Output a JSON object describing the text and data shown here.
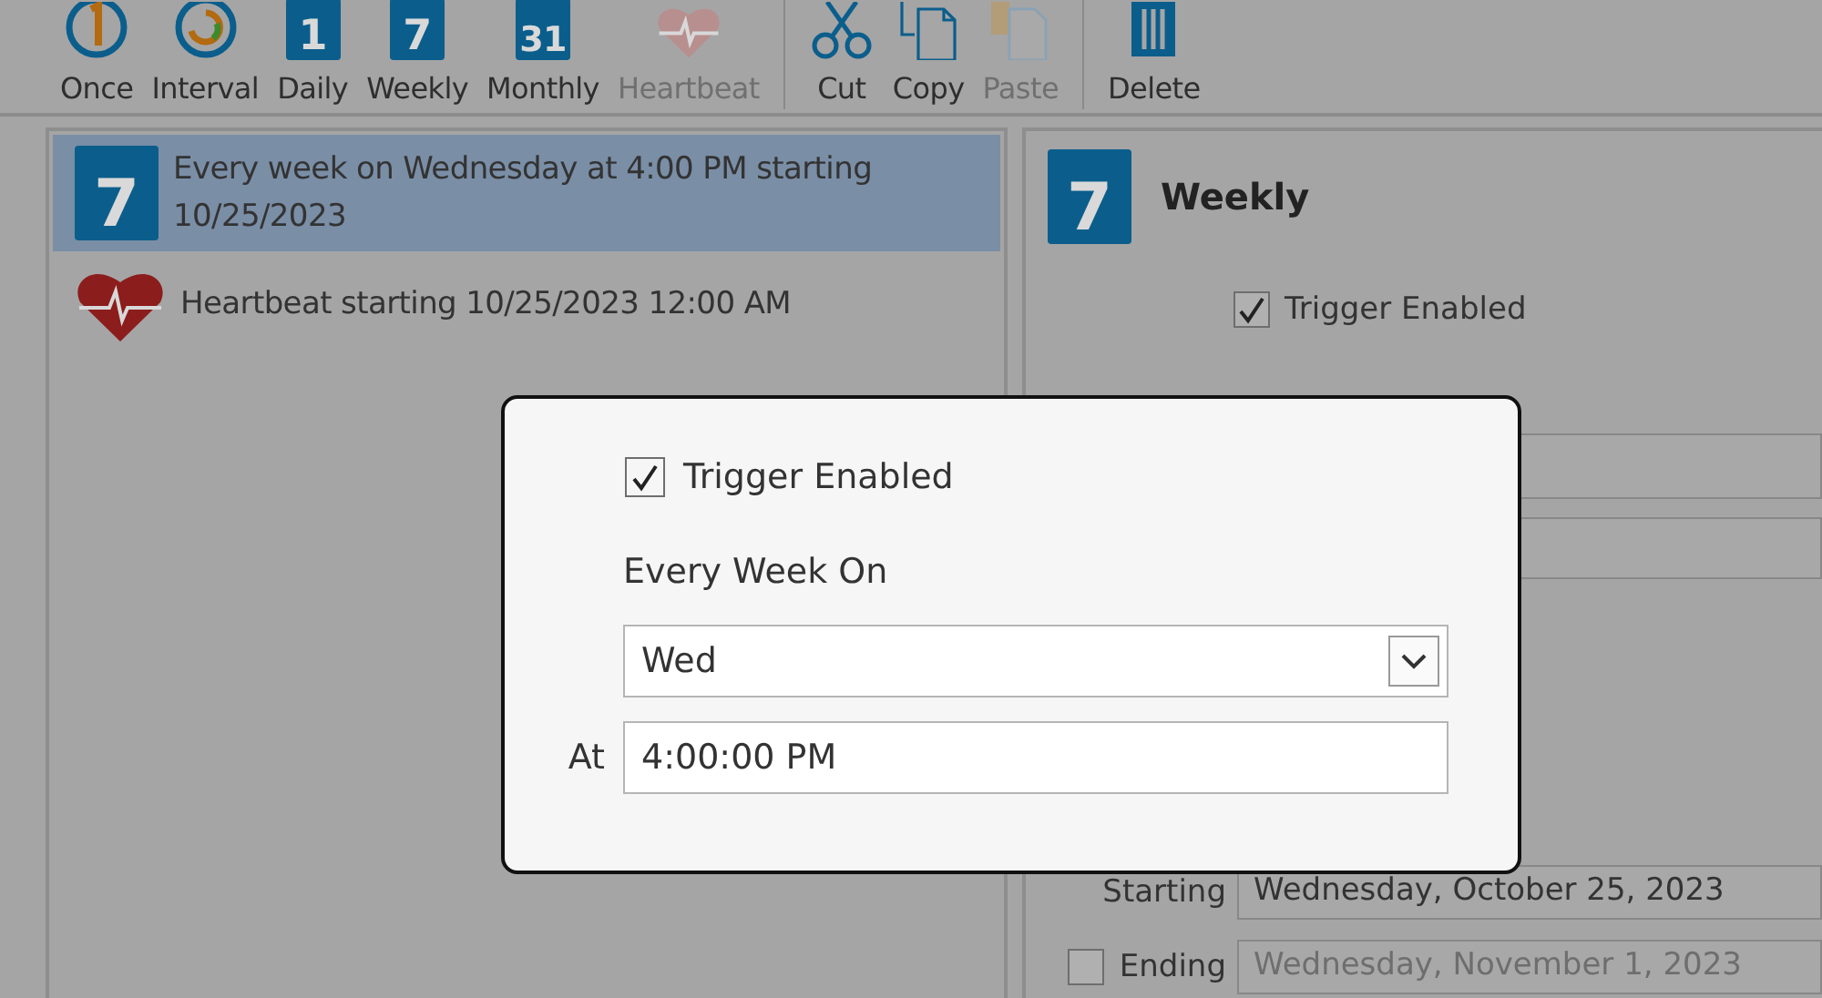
{
  "toolbar": {
    "groups": [
      [
        {
          "label": "Once",
          "kind": "once",
          "disabled": false
        },
        {
          "label": "Interval",
          "kind": "interval",
          "disabled": false
        },
        {
          "label": "Daily",
          "kind": "calendar",
          "number": "1",
          "disabled": false
        },
        {
          "label": "Weekly",
          "kind": "calendar",
          "number": "7",
          "disabled": false
        },
        {
          "label": "Monthly",
          "kind": "calendar",
          "number": "31",
          "disabled": false
        },
        {
          "label": "Heartbeat",
          "kind": "heart",
          "disabled": true
        }
      ],
      [
        {
          "label": "Cut",
          "kind": "cut",
          "disabled": false
        },
        {
          "label": "Copy",
          "kind": "copy",
          "disabled": false
        },
        {
          "label": "Paste",
          "kind": "paste",
          "disabled": true
        }
      ],
      [
        {
          "label": "Delete",
          "kind": "delete",
          "disabled": false
        }
      ]
    ]
  },
  "triggers": [
    {
      "text": "Every week on Wednesday at 4:00 PM starting 10/25/2023",
      "kind": "calendar",
      "number": "7",
      "selected": true
    },
    {
      "text": "Heartbeat starting 10/25/2023 12:00 AM",
      "kind": "heart",
      "selected": false
    }
  ],
  "details": {
    "title": "Weekly",
    "number": "7",
    "trigger": {
      "label": "Trigger Enabled",
      "checked": true
    },
    "starting": {
      "label": "Starting",
      "value": "Wednesday, October 25, 2023"
    },
    "ending": {
      "label": "Ending",
      "checked": false,
      "value": "Wednesday, November 1, 2023"
    }
  },
  "popup": {
    "trigger": {
      "label": "Trigger Enabled",
      "checked": true
    },
    "every_week_on": {
      "label": "Every Week On",
      "value": "Wed"
    },
    "at": {
      "label": "At",
      "value": "4:00:00 PM"
    }
  }
}
